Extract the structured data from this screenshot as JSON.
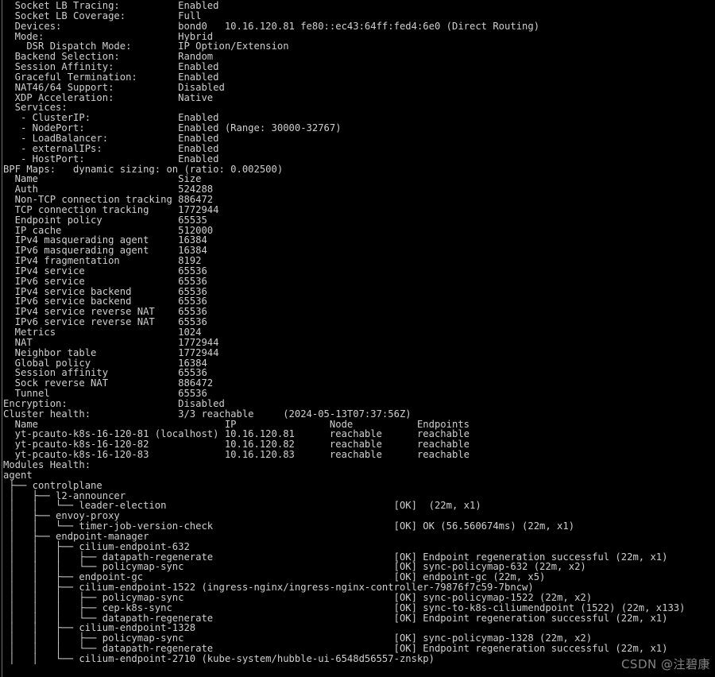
{
  "terminal": {
    "colors": {
      "background": "#000000",
      "foreground": "#cfcfcf",
      "gutter": "#6f6f6f",
      "watermark": "#e1e1e1"
    },
    "columns": 124,
    "rows": 66
  },
  "watermark": {
    "text": "CSDN @注碧康"
  },
  "status": {
    "socket_lb_tracing": {
      "label": "Socket LB Tracing:",
      "value": "Enabled"
    },
    "socket_lb_coverage": {
      "label": "Socket LB Coverage:",
      "value": "Full"
    },
    "devices": {
      "label": "Devices:",
      "value": "bond0   10.16.120.81 fe80::ec43:64ff:fed4:6e0 (Direct Routing)"
    },
    "mode": {
      "label": "Mode:",
      "value": "Hybrid"
    },
    "dsr_dispatch_mode": {
      "label": "DSR Dispatch Mode:",
      "value": "IP Option/Extension"
    },
    "backend_selection": {
      "label": "Backend Selection:",
      "value": "Random"
    },
    "session_affinity": {
      "label": "Session Affinity:",
      "value": "Enabled"
    },
    "graceful_termination": {
      "label": "Graceful Termination:",
      "value": "Enabled"
    },
    "nat46_64_support": {
      "label": "NAT46/64 Support:",
      "value": "Disabled"
    },
    "xdp_acceleration": {
      "label": "XDP Acceleration:",
      "value": "Native"
    },
    "services_label": "Services:",
    "services": [
      {
        "label": "- ClusterIP:",
        "value": "Enabled"
      },
      {
        "label": "- NodePort:",
        "value": "Enabled (Range: 30000-32767)"
      },
      {
        "label": "- LoadBalancer:",
        "value": "Enabled"
      },
      {
        "label": "- externalIPs:",
        "value": "Enabled"
      },
      {
        "label": "- HostPort:",
        "value": "Enabled"
      }
    ],
    "bpf_maps": {
      "header": "BPF Maps:   dynamic sizing: on (ratio: 0.002500)",
      "columns": [
        "Name",
        "Size"
      ],
      "rows": [
        [
          "Auth",
          "524288"
        ],
        [
          "Non-TCP connection tracking",
          "886472"
        ],
        [
          "TCP connection tracking",
          "1772944"
        ],
        [
          "Endpoint policy",
          "65535"
        ],
        [
          "IP cache",
          "512000"
        ],
        [
          "IPv4 masquerading agent",
          "16384"
        ],
        [
          "IPv6 masquerading agent",
          "16384"
        ],
        [
          "IPv4 fragmentation",
          "8192"
        ],
        [
          "IPv4 service",
          "65536"
        ],
        [
          "IPv6 service",
          "65536"
        ],
        [
          "IPv4 service backend",
          "65536"
        ],
        [
          "IPv6 service backend",
          "65536"
        ],
        [
          "IPv4 service reverse NAT",
          "65536"
        ],
        [
          "IPv6 service reverse NAT",
          "65536"
        ],
        [
          "Metrics",
          "1024"
        ],
        [
          "NAT",
          "1772944"
        ],
        [
          "Neighbor table",
          "1772944"
        ],
        [
          "Global policy",
          "16384"
        ],
        [
          "Session affinity",
          "65536"
        ],
        [
          "Sock reverse NAT",
          "886472"
        ],
        [
          "Tunnel",
          "65536"
        ]
      ]
    },
    "encryption": {
      "label": "Encryption:",
      "value": "Disabled"
    },
    "cluster_health": {
      "label": "Cluster health:",
      "value": "3/3 reachable",
      "timestamp": "(2024-05-13T07:37:56Z)",
      "columns": [
        "Name",
        "IP",
        "Node",
        "Endpoints"
      ],
      "rows": [
        [
          "yt-pcauto-k8s-16-120-81 (localhost)",
          "10.16.120.81",
          "reachable",
          "reachable"
        ],
        [
          "yt-pcauto-k8s-16-120-82",
          "10.16.120.82",
          "reachable",
          "reachable"
        ],
        [
          "yt-pcauto-k8s-16-120-83",
          "10.16.120.83",
          "reachable",
          "reachable"
        ]
      ]
    },
    "modules_health": {
      "label": "Modules Health:",
      "rows": [
        {
          "tree": "agent",
          "status": "",
          "detail": ""
        },
        {
          "tree": " ├── controlplane",
          "status": "",
          "detail": ""
        },
        {
          "tree": " │   ├── l2-announcer",
          "status": "",
          "detail": ""
        },
        {
          "tree": " │   │   └── leader-election",
          "status": "[OK]",
          "detail": " (22m, x1)"
        },
        {
          "tree": " │   ├── envoy-proxy",
          "status": "",
          "detail": ""
        },
        {
          "tree": " │   │   └── timer-job-version-check",
          "status": "[OK]",
          "detail": "OK (56.560674ms) (22m, x1)"
        },
        {
          "tree": " │   ├── endpoint-manager",
          "status": "",
          "detail": ""
        },
        {
          "tree": " │   │   ├── cilium-endpoint-632",
          "status": "",
          "detail": ""
        },
        {
          "tree": " │   │   │   ├── datapath-regenerate",
          "status": "[OK]",
          "detail": "Endpoint regeneration successful (22m, x1)"
        },
        {
          "tree": " │   │   │   └── policymap-sync",
          "status": "[OK]",
          "detail": "sync-policymap-632 (22m, x2)"
        },
        {
          "tree": " │   │   ├── endpoint-gc",
          "status": "[OK]",
          "detail": "endpoint-gc (22m, x5)"
        },
        {
          "tree": " │   │   ├── cilium-endpoint-1522 (ingress-nginx/ingress-nginx-controller-79876f7c59-7bncw)",
          "status": "",
          "detail": ""
        },
        {
          "tree": " │   │   │   ├── policymap-sync",
          "status": "[OK]",
          "detail": "sync-policymap-1522 (22m, x2)"
        },
        {
          "tree": " │   │   │   ├── cep-k8s-sync",
          "status": "[OK]",
          "detail": "sync-to-k8s-ciliumendpoint (1522) (22m, x133)"
        },
        {
          "tree": " │   │   │   └── datapath-regenerate",
          "status": "[OK]",
          "detail": "Endpoint regeneration successful (22m, x1)"
        },
        {
          "tree": " │   │   ├── cilium-endpoint-1328",
          "status": "",
          "detail": ""
        },
        {
          "tree": " │   │   │   ├── policymap-sync",
          "status": "[OK]",
          "detail": "sync-policymap-1328 (22m, x2)"
        },
        {
          "tree": " │   │   │   └── datapath-regenerate",
          "status": "[OK]",
          "detail": "Endpoint regeneration successful (22m, x1)"
        },
        {
          "tree": " │   │   └── cilium-endpoint-2710 (kube-system/hubble-ui-6548d56557-znskp)",
          "status": "",
          "detail": ""
        }
      ]
    }
  }
}
